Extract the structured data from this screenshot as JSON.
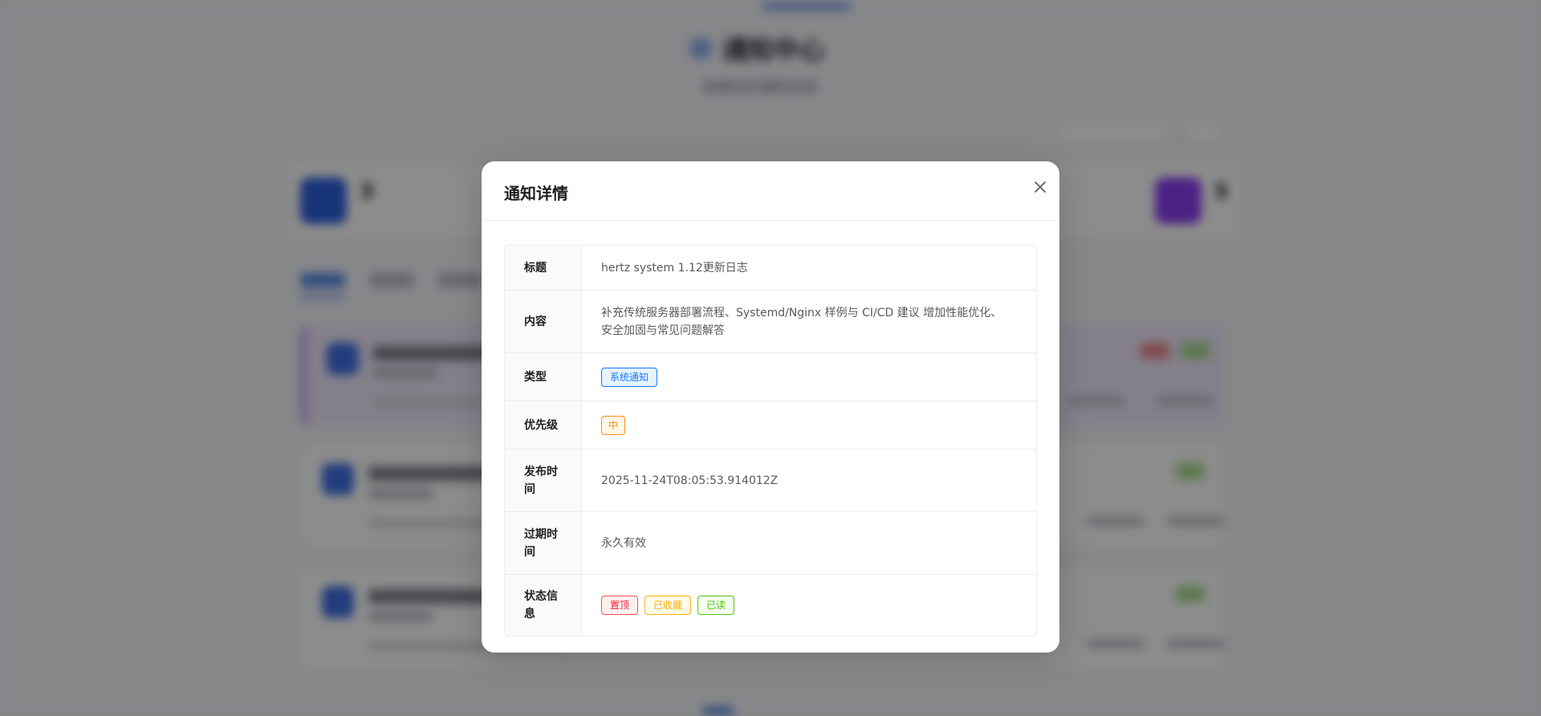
{
  "background": {
    "page_title": "通知中心",
    "page_subtitle": "查看您的通知消息",
    "stat_first_value": "3",
    "stat_last_value": "5"
  },
  "modal": {
    "title": "通知详情",
    "rows": {
      "title": {
        "label": "标题",
        "value": "hertz system 1.12更新日志"
      },
      "content": {
        "label": "内容",
        "value": "补充传统服务器部署流程、Systemd/Nginx 样例与 CI/CD 建议 增加性能优化、安全加固与常见问题解答"
      },
      "type": {
        "label": "类型",
        "value": "系统通知"
      },
      "priority": {
        "label": "优先级",
        "value": "中"
      },
      "published": {
        "label": "发布时间",
        "value": "2025-11-24T08:05:53.914012Z"
      },
      "expires": {
        "label": "过期时间",
        "value": "永久有效"
      },
      "status": {
        "label": "状态信息",
        "tags": [
          "置顶",
          "已收藏",
          "已读"
        ]
      }
    }
  },
  "colors": {
    "primary": "#1677ff",
    "warning": "#fa8c16",
    "danger": "#f5222d",
    "gold": "#faad14",
    "success": "#52c41a"
  },
  "icons": {
    "close": "close-icon"
  }
}
